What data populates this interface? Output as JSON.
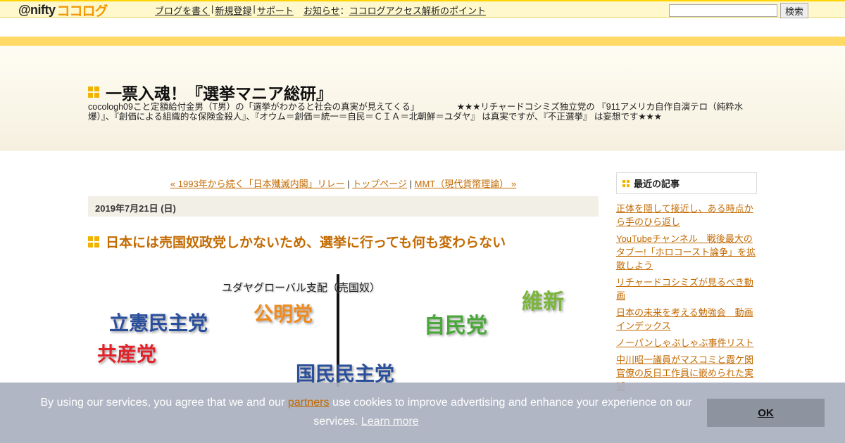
{
  "topbar": {
    "logo_nifty": "@nifty",
    "logo_cocolog": "ココログ",
    "nav": [
      "ブログを書く",
      "新規登録",
      "サポート"
    ],
    "info_label": "お知らせ",
    "info_sep": "：",
    "info_link": "ココログアクセス解析のポイント",
    "search_value": "",
    "search_button": "検索"
  },
  "header": {
    "title": "一票入魂！『選挙マニア総研』",
    "description": "cocologh09こと定額給付金男（T男）の「選挙がわかると社会の真実が見えてくる」 　　　　★★★リチャードコシミズ独立党の 『911アメリカ自作自演テロ（純粋水爆）』、『創価による組織的な保険金殺人』、『オウム＝創価＝統一＝自民＝ＣＩＡ＝北朝鮮＝ユダヤ』 は真実ですが、『不正選挙』 は妄想です★★★"
  },
  "post_nav": {
    "prev": "« 1993年から続く「日本殲滅内閣」リレー",
    "sep1": " | ",
    "top": "トップページ",
    "sep2": " | ",
    "next": "MMT（現代貨幣理論） »"
  },
  "post": {
    "date": "2019年7月21日 (日)",
    "title": "日本には売国奴政党しかないため、選挙に行っても何も変わらない",
    "figure": {
      "caption": "ユダヤグローバル支配（売国奴）",
      "parties": {
        "rikken": "立憲民主党",
        "komei": "公明党",
        "jimin": "自民党",
        "ishin": "維新",
        "kyosan": "共産党",
        "kokumin": "国民民主党"
      }
    }
  },
  "sidebar": {
    "heading": "最近の記事",
    "items": [
      "正体を隠して接近し、ある時点から手のひら返し",
      "YouTubeチャンネル　戦後最大のタブー!「ホロコースト論争」を拡散しよう",
      "リチャードコシミズが見るべき動画",
      "日本の未来を考える勉強会　動画インデックス",
      "ノーパンしゃぶしゃぶ事件リスト",
      "中川昭一議員がマスコミと霞ケ関官僚の反日工作員に嵌められた実話"
    ]
  },
  "cookie": {
    "text_before": "By using our services, you agree that we and our ",
    "partners": "partners",
    "text_after": " use cookies to improve advertising and enhance your experience on our services. ",
    "learn_more": "Learn more",
    "ok": "OK"
  }
}
